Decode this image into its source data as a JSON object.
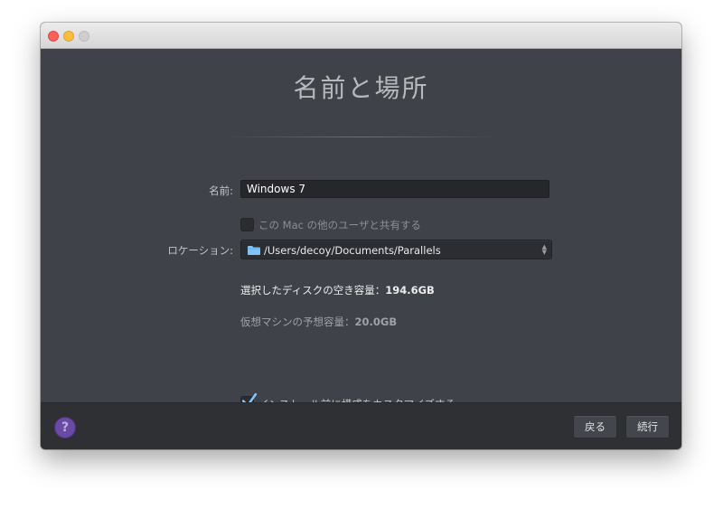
{
  "dialog": {
    "title": "名前と場所"
  },
  "form": {
    "name_label": "名前:",
    "name_value": "Windows 7",
    "share_checkbox": {
      "label": "この Mac の他のユーザと共有する",
      "checked": false,
      "enabled": false
    },
    "location_label": "ロケーション:",
    "location_value": "/Users/decoy/Documents/Parallels",
    "location_icon": "folder-icon"
  },
  "info": {
    "free_space_label": "選択したディスクの空き容量：",
    "free_space_value": "194.6GB",
    "vm_size_label": "仮想マシンの予想容量：",
    "vm_size_value": "20.0GB"
  },
  "customize_checkbox": {
    "label": "インストール前に構成をカスタマイズする",
    "checked": true
  },
  "footer": {
    "help_icon": "help-icon",
    "help_glyph": "?",
    "back_label": "戻る",
    "continue_label": "続行"
  },
  "colors": {
    "background": "#3f4249",
    "footer": "#2e3034",
    "accent_check": "#7fc8ff",
    "help": "#6b4aa6"
  }
}
